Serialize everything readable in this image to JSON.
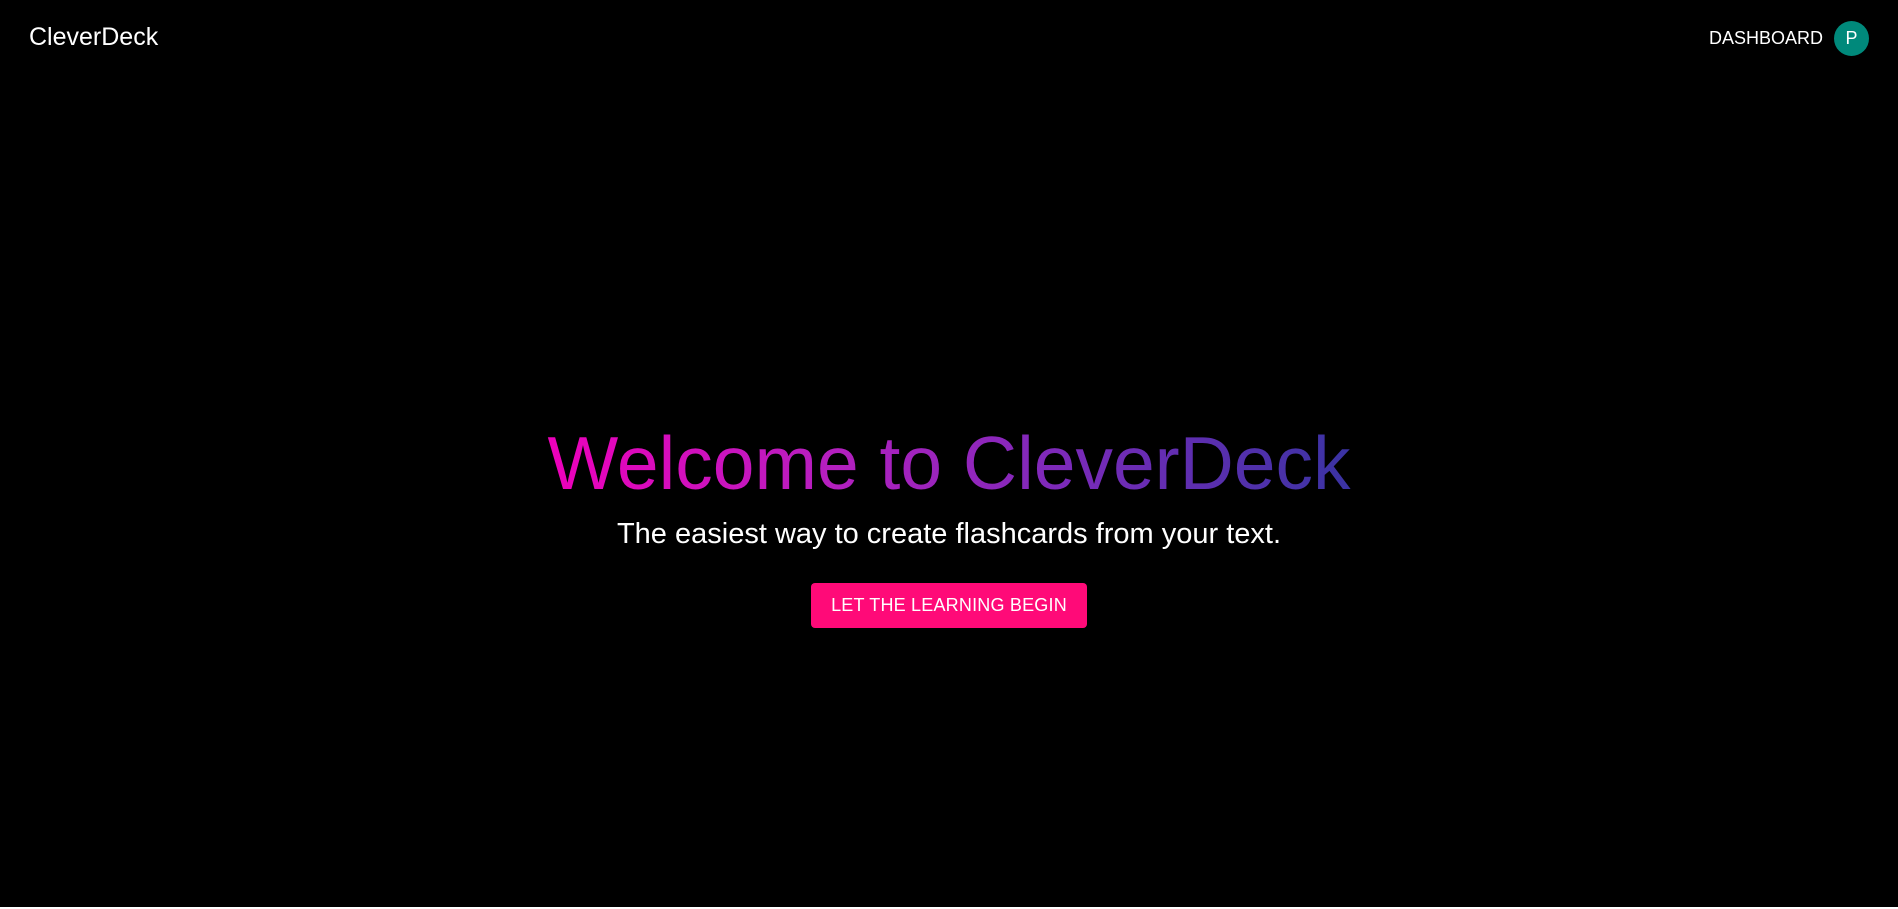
{
  "header": {
    "brand": "CleverDeck",
    "nav_dashboard": "DASHBOARD",
    "avatar_initial": "P",
    "avatar_color": "#00897b"
  },
  "hero": {
    "title": "Welcome to CleverDeck",
    "subtitle": "The easiest way to create flashcards from your text.",
    "cta_label": "LET THE LEARNING BEGIN",
    "title_gradient": [
      "#ee00bb",
      "#3a33a3"
    ],
    "cta_color": "#ff0a78"
  }
}
